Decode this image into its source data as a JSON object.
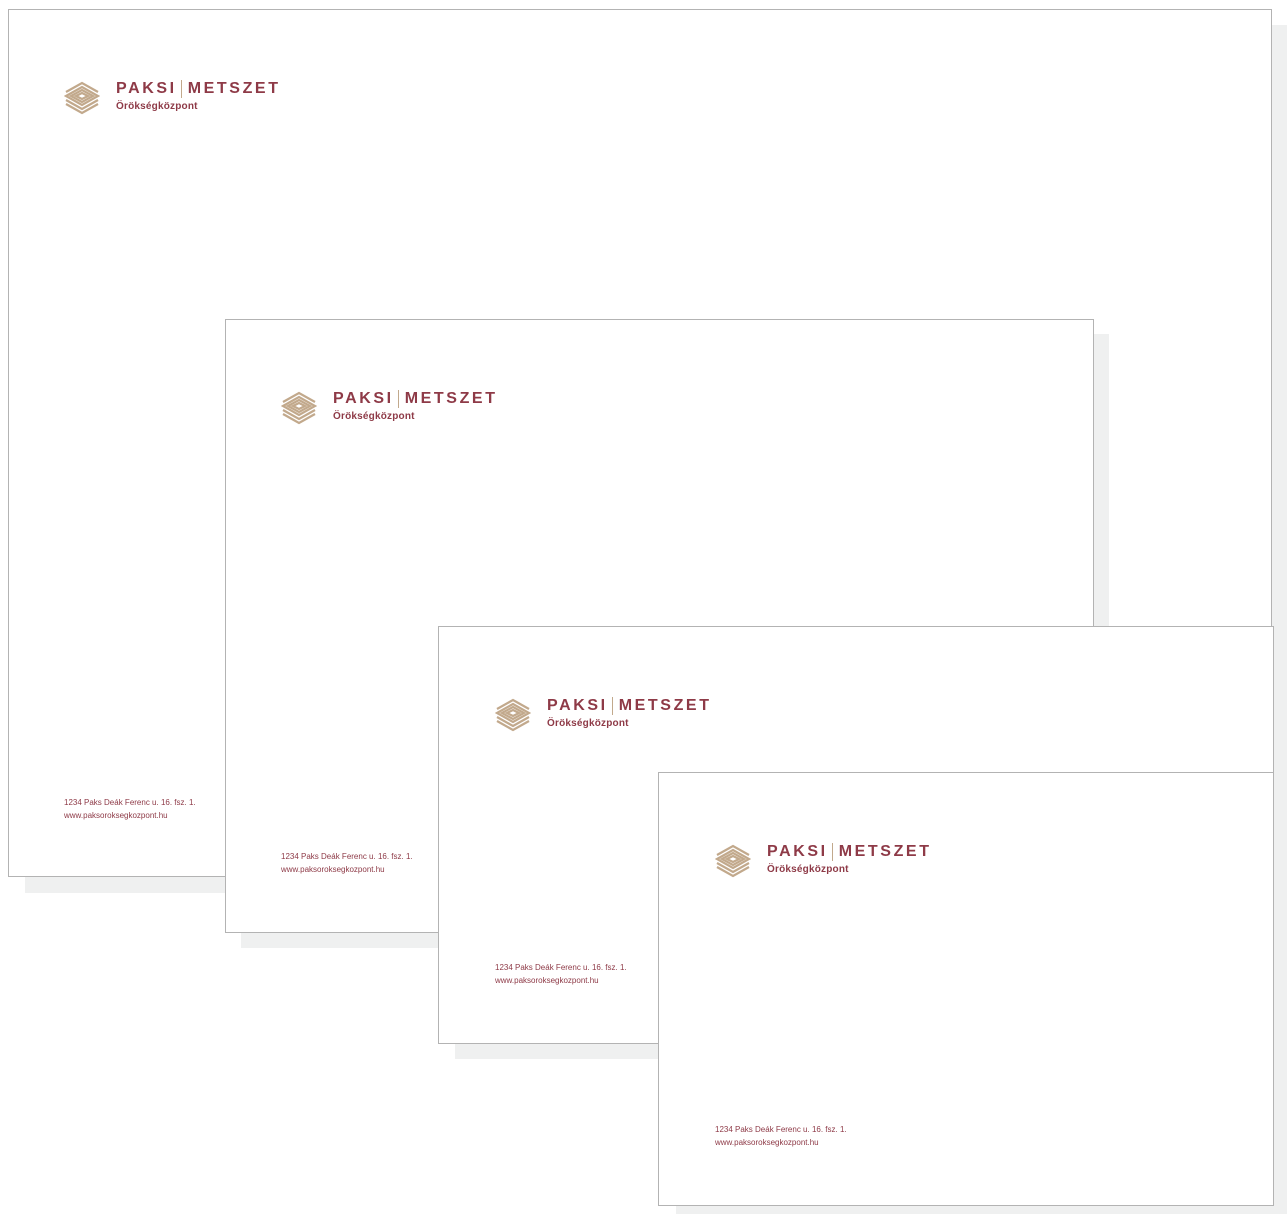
{
  "brand": {
    "name_left": "PAKSI",
    "name_right": "METSZET",
    "subtitle": "Örökségközpont",
    "primary_color": "#8e3a47",
    "accent_color": "#c2a98c",
    "logo_icon": "stacked-layers-icon"
  },
  "contact": {
    "address": "1234 Paks Deák Ferenc u. 16. fsz. 1.",
    "website": "www.paksoroksegkozpont.hu"
  }
}
